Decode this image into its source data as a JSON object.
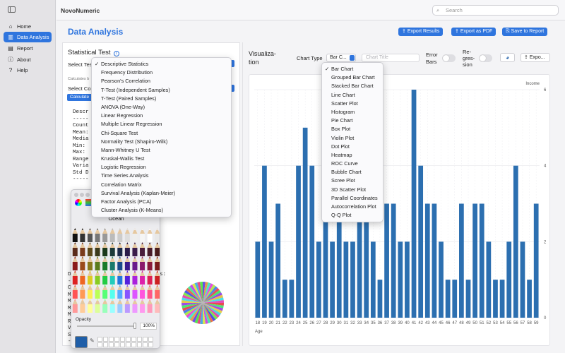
{
  "app": {
    "title": "NovoNumeric"
  },
  "search": {
    "placeholder": "Search"
  },
  "sidebar": {
    "items": [
      {
        "label": "Home",
        "icon": "house-icon",
        "active": false
      },
      {
        "label": "Data Analysis",
        "icon": "chart-icon",
        "active": true
      },
      {
        "label": "Report",
        "icon": "doc-icon",
        "active": false
      },
      {
        "label": "About",
        "icon": "info-icon",
        "active": false
      },
      {
        "label": "Help",
        "icon": "help-icon",
        "active": false
      }
    ]
  },
  "page": {
    "title": "Data Analysis"
  },
  "toolbar": {
    "export_results": "Export Results",
    "export_pdf": "Export as PDF",
    "save_report": "Save to Report"
  },
  "stat": {
    "title": "Statistical Test",
    "select_test_label": "Select Tes",
    "calc_hint": "Calculates b",
    "select_col_label": "Select Co",
    "calc_btn": "Calculate",
    "output_lines": [
      "Descr",
      "-----",
      "Count",
      "Mean:",
      "Media",
      "Min:",
      "Max:",
      "Range",
      "Varia",
      "Std D",
      "-----"
    ],
    "output2_lines": [
      "D",
      "-",
      "C",
      "M",
      "M",
      "M",
      "M",
      "R",
      "V",
      "S",
      "-"
    ],
    "output2_suffix": "s:"
  },
  "test_menu": {
    "items": [
      "Descriptive Statistics",
      "Frequency Distribution",
      "Pearson's Correlation",
      "T-Test (Independent Samples)",
      "T-Test (Paired Samples)",
      "ANOVA (One-Way)",
      "Linear Regression",
      "Multiple Linear Regression",
      "Chi-Square Test",
      "Normality Test (Shapiro-Wilk)",
      "Mann-Whitney U Test",
      "Kruskal-Wallis Test",
      "Logistic Regression",
      "Time Series Analysis",
      "Correlation Matrix",
      "Survival Analysis (Kaplan-Meier)",
      "Factor Analysis (PCA)",
      "Cluster Analysis (K-Means)"
    ],
    "selected": 0
  },
  "viz": {
    "title_lines": [
      "Visualiza-",
      "tion"
    ],
    "chart_type_label": "Chart Type",
    "chart_type_value": "Bar C...",
    "chart_title_placeholder": "Chart Title",
    "error_bars_lines": [
      "Error",
      "Bars"
    ],
    "regression_lines": [
      "Re-",
      "gres-",
      "sion"
    ],
    "export_label": "Expo..."
  },
  "chart_menu": {
    "items": [
      "Bar Chart",
      "Grouped Bar Chart",
      "Stacked Bar Chart",
      "Line Chart",
      "Scatter Plot",
      "Histogram",
      "Pie Chart",
      "Box Plot",
      "Violin Plot",
      "Dot Plot",
      "Heatmap",
      "ROC Curve",
      "Bubble Chart",
      "Scree Plot",
      "3D Scatter Plot",
      "Parallel Coordinates",
      "Autocorrelation Plot",
      "Q-Q Plot"
    ],
    "selected": 0
  },
  "color_panel": {
    "palette_name": "Ocean",
    "opacity_label": "Opacity",
    "opacity_value": "100%",
    "current_color": "#1f5ea8"
  },
  "chart_data": {
    "type": "bar",
    "xlabel": "Age",
    "ylabel": "Income",
    "ylim": [
      0,
      6
    ],
    "yticks": [
      0,
      2,
      4,
      6
    ],
    "color": "#2c6fb0",
    "categories": [
      "18",
      "19",
      "20",
      "21",
      "22",
      "23",
      "24",
      "25",
      "26",
      "27",
      "28",
      "29",
      "30",
      "31",
      "32",
      "33",
      "34",
      "35",
      "36",
      "37",
      "38",
      "39",
      "40",
      "41",
      "42",
      "43",
      "44",
      "45",
      "46",
      "47",
      "48",
      "49",
      "50",
      "51",
      "52",
      "53",
      "54",
      "55",
      "56",
      "57",
      "58",
      "59"
    ],
    "values": [
      2,
      4,
      2,
      3,
      1,
      1,
      4,
      5,
      4,
      2,
      3,
      2,
      3,
      2,
      2,
      3,
      3,
      2,
      1,
      3,
      3,
      2,
      2,
      6,
      4,
      3,
      3,
      2,
      1,
      1,
      3,
      1,
      3,
      3,
      2,
      1,
      1,
      2,
      4,
      2,
      1,
      3
    ]
  }
}
